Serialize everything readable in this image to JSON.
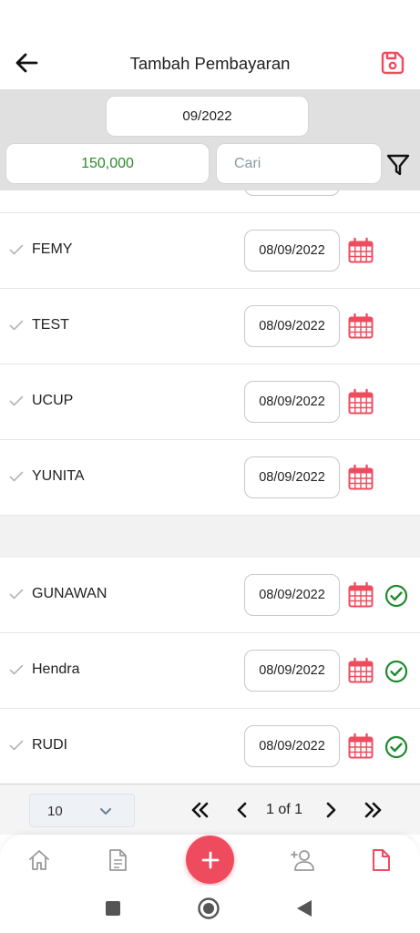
{
  "header": {
    "title": "Tambah Pembayaran",
    "back_icon": "arrow-left-icon",
    "save_icon": "floppy-disk-icon"
  },
  "filters": {
    "month": "09/2022",
    "amount": "150,000",
    "search_placeholder": "Cari",
    "filter_icon": "funnel-icon"
  },
  "group_pending": [
    {
      "name": "FEMY",
      "date": "08/09/2022"
    },
    {
      "name": "TEST",
      "date": "08/09/2022"
    },
    {
      "name": "UCUP",
      "date": "08/09/2022"
    },
    {
      "name": "YUNITA",
      "date": "08/09/2022"
    }
  ],
  "group_paid": [
    {
      "name": "GUNAWAN",
      "date": "08/09/2022"
    },
    {
      "name": "Hendra",
      "date": "08/09/2022"
    },
    {
      "name": "RUDI",
      "date": "08/09/2022"
    }
  ],
  "pagination": {
    "page_size": "10",
    "page_info": "1 of 1"
  },
  "bottom_nav": {
    "items": [
      "home-icon",
      "document-icon",
      "add-icon",
      "add-person-icon",
      "file-icon"
    ],
    "active": "file-icon"
  },
  "colors": {
    "accent": "#ef4b5e",
    "amount_green": "#2a8a2a",
    "check_green": "#1f8a2e",
    "filter_bar": "#e0e0e0"
  }
}
